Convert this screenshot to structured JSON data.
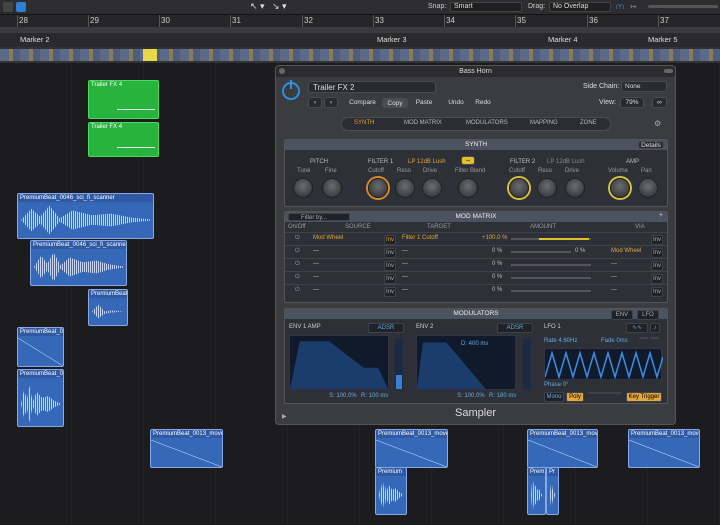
{
  "topbar": {
    "snap_label": "Snap:",
    "snap_value": "Smart",
    "drag_label": "Drag:",
    "drag_value": "No Overlap"
  },
  "ruler": {
    "bars": [
      "28",
      "29",
      "30",
      "31",
      "32",
      "33",
      "34",
      "35",
      "36",
      "37"
    ]
  },
  "markers": [
    "Marker 2",
    "Marker 3",
    "Marker 4",
    "Marker 5"
  ],
  "regions": {
    "green": [
      "Trailer FX 4",
      "Trailer FX 4"
    ],
    "blue": [
      "PremiumBeat_0046_sci_fi_scanner",
      "PremiumBeat_0046_sci_fi_scanner_3",
      "PremiumBeat_",
      "PremiumBeat_00",
      "PremiumBeat_00",
      "PremiumBeat_0013_move_",
      "PremiumBeat_0013_move_",
      "PremiumBeat_0013_move_",
      "PremiumBeat_0013_move_",
      "Premium",
      "Prem",
      "Pr"
    ]
  },
  "plugin": {
    "window_title": "Bass Horn",
    "preset": "Trailer FX 2",
    "side_chain_label": "Side Chain:",
    "side_chain_value": "None",
    "view_label": "View:",
    "view_value": "79%",
    "actions": [
      "Compare",
      "Copy",
      "Paste",
      "Undo",
      "Redo"
    ],
    "tabs": [
      "SYNTH",
      "MOD MATRIX",
      "MODULATORS",
      "MAPPING",
      "ZONE"
    ],
    "footer_name": "Sampler",
    "synth": {
      "header": "SYNTH",
      "details": "Details",
      "pitch": "PITCH",
      "tune": "Tune",
      "fine": "Fine",
      "filter1": "FILTER 1",
      "filter1_type": "LP 12dB Lush",
      "filter2": "FILTER 2",
      "filter2_type": "LP 12dB Lush",
      "cutoff": "Cutoff",
      "reso": "Reso",
      "drive": "Drive",
      "filter_blend": "Filter Blend",
      "amp": "AMP",
      "volume": "Volume",
      "pan": "Pan"
    },
    "modmatrix": {
      "header": "MOD MATRIX",
      "filter_placeholder": "Filter by...",
      "columns": [
        "On/Off",
        "SOURCE",
        "TARGET",
        "AMOUNT",
        "VIA"
      ],
      "rows": [
        {
          "source": "Mod Wheel",
          "inv": "Inv",
          "target": "Filter 1 Cutoff",
          "amount": "+100.0 %",
          "via_amount": "",
          "via": "",
          "via_inv": "Inv"
        },
        {
          "source": "—",
          "inv": "Inv",
          "target": "—",
          "amount": "0 %",
          "via_amount": "0 %",
          "via": "Mod Wheel",
          "via_inv": "Inv"
        },
        {
          "source": "—",
          "inv": "Inv",
          "target": "—",
          "amount": "0 %",
          "via_amount": "",
          "via": "—",
          "via_inv": "Inv"
        },
        {
          "source": "—",
          "inv": "Inv",
          "target": "—",
          "amount": "0 %",
          "via_amount": "",
          "via": "—",
          "via_inv": "Inv"
        },
        {
          "source": "—",
          "inv": "Inv",
          "target": "—",
          "amount": "0 %",
          "via_amount": "",
          "via": "—",
          "via_inv": "Inv"
        }
      ]
    },
    "modulators": {
      "header": "MODULATORS",
      "env_btn": "ENV",
      "lfo_btn": "LFO",
      "env1": "ENV 1 AMP",
      "env2": "ENV 2",
      "adsr": "ADSR",
      "lfo1": "LFO 1",
      "rate": "Rate 4.60Hz",
      "fade": "Fade 0ms",
      "phase": "Phase 0°",
      "mono": "Mono",
      "poly": "Poly",
      "key_trigger": "Key Trigger",
      "env1_s": "S: 100.0%",
      "env1_r": "R: 100 ms",
      "env2_d": "D: 400 ms",
      "env2_s": "S: 100.0%",
      "env2_r": "R: 180 ms"
    }
  },
  "colors": {
    "accent_blue": "#2e8fe0",
    "orange": "#d8892c",
    "green_region": "#27b33e",
    "blue_region": "#3668b8"
  }
}
